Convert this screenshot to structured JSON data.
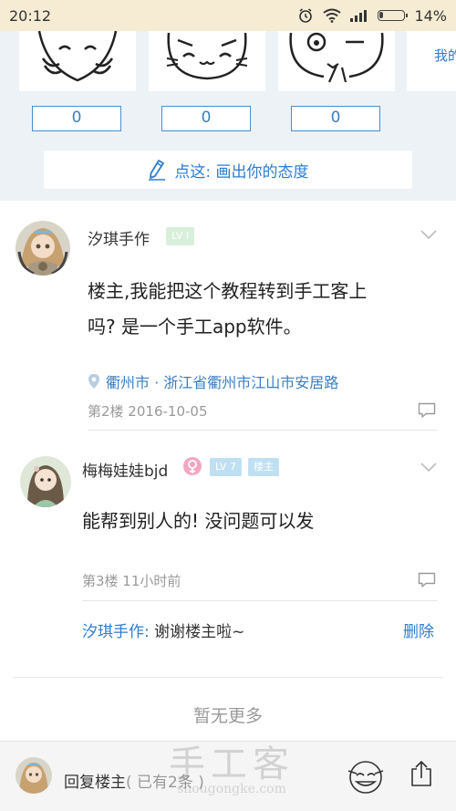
{
  "status_bar": {
    "time": "20:12",
    "battery": "14%",
    "battery_level": 0.14
  },
  "stickers": {
    "counts": [
      "0",
      "0",
      "0"
    ],
    "next_label": "我的",
    "draw_prompt": "点这: 画出你的态度"
  },
  "posts": [
    {
      "user": "汐琪手作",
      "level": "LV I",
      "content_line1": "楼主,我能把这个教程转到手工客上",
      "content_line2": "吗? 是一个手工app软件。",
      "location": "衢州市 · 浙江省衢州市江山市安居路",
      "meta": "第2楼 2016-10-05"
    },
    {
      "user": "梅梅娃娃bjd",
      "level": "LV 7",
      "role_badge": "楼主",
      "content": "能帮到别人的! 没问题可以发",
      "meta": "第3楼 11小时前",
      "reply": {
        "user": "汐琪手作:",
        "text": " 谢谢楼主啦~",
        "delete": "删除"
      }
    }
  ],
  "no_more": "暂无更多",
  "bottom_bar": {
    "reply_label": "回复楼主",
    "reply_count": "( 已有2条 )"
  },
  "watermark": {
    "big": "手工客",
    "small": "shougongke.com"
  },
  "colors": {
    "accent": "#2d7cd0",
    "status_bg": "#f6ecd3",
    "sticker_bg": "#ecf2f6"
  }
}
